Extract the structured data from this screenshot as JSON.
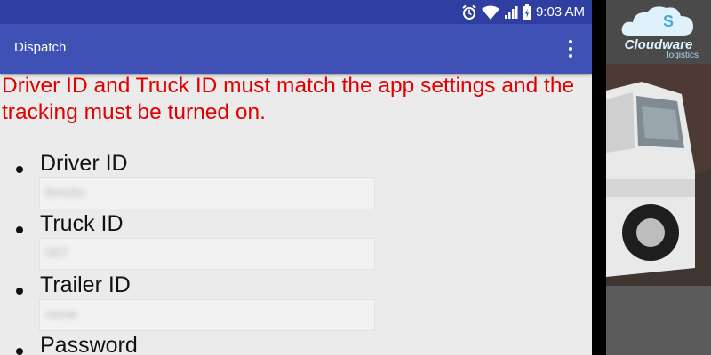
{
  "status_bar": {
    "time": "9:03 AM",
    "icons": [
      "alarm-icon",
      "wifi-icon",
      "signal-icon",
      "battery-icon"
    ]
  },
  "app_bar": {
    "title": "Dispatch",
    "menu_icon": "overflow-menu-icon"
  },
  "warning_text": "Driver ID and Truck ID must match the app settings and the tracking must be turned on.",
  "fields": [
    {
      "label": "Driver ID",
      "value": "bmoto"
    },
    {
      "label": "Truck ID",
      "value": "007"
    },
    {
      "label": "Trailer ID",
      "value": "none"
    },
    {
      "label": "Password",
      "value": ""
    }
  ],
  "sidebar": {
    "logo_text": "Cloudware",
    "logo_subtext": "logistics"
  },
  "colors": {
    "status_bar": "#2e3fa1",
    "app_bar": "#3f51b5",
    "warning": "#e00000",
    "background": "#ebebeb"
  }
}
